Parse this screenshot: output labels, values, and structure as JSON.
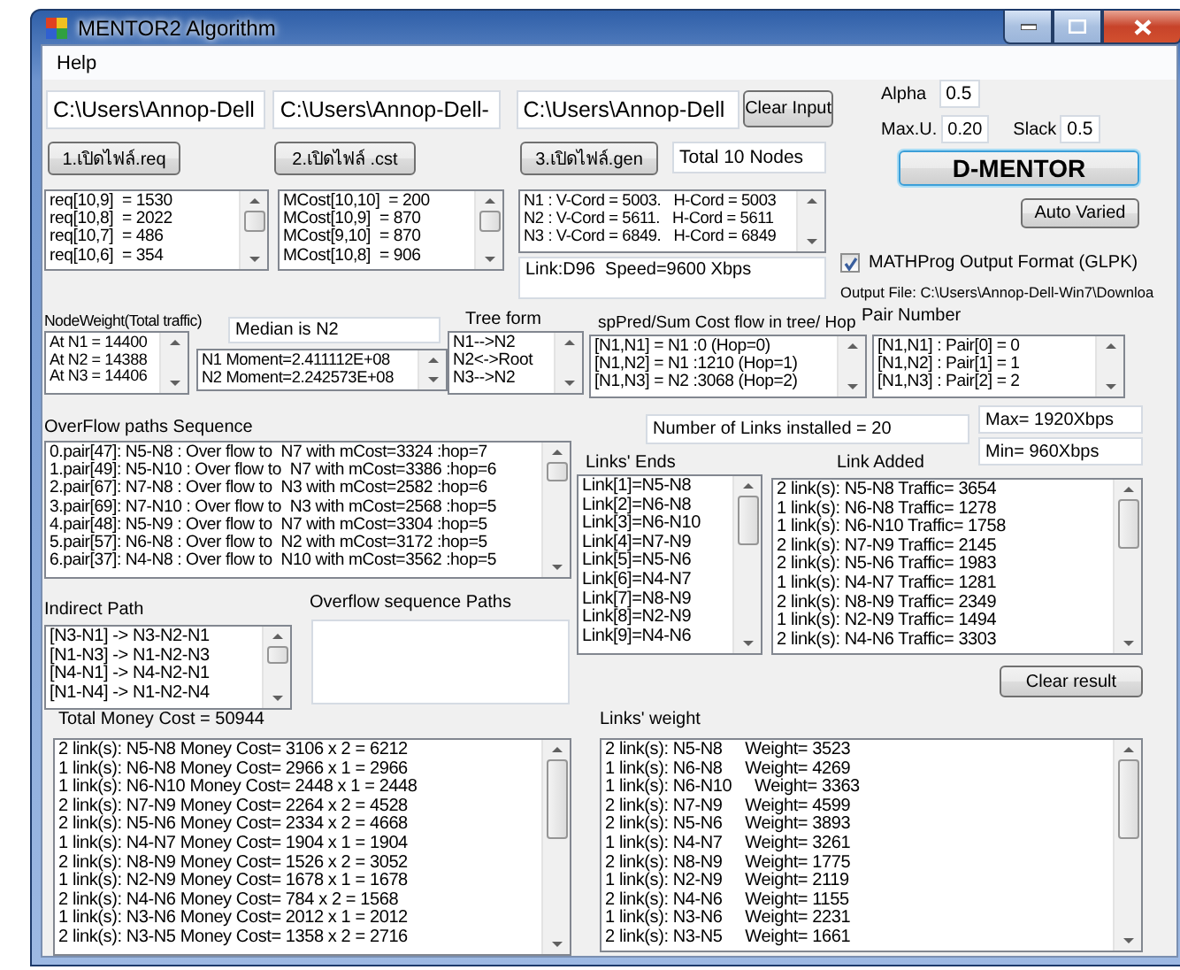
{
  "window": {
    "title": "MENTOR2 Algorithm"
  },
  "menu": [
    "Help"
  ],
  "file_inputs": [
    {
      "value": "C:\\Users\\Annop-Dell"
    },
    {
      "value": "C:\\Users\\Annop-Dell-"
    },
    {
      "value": "C:\\Users\\Annop-Dell"
    }
  ],
  "clear_input_button": "Clear Input",
  "open_buttons": [
    "1.เปิดไฟล์.req",
    "2.เปิดไฟล์ .cst",
    "3.เปิดไฟล์.gen"
  ],
  "total_nodes": "Total 10 Nodes",
  "req_list": [
    "req[10,9]  = 1530",
    "req[10,8]  = 2022",
    "req[10,7]  = 486",
    "req[10,6]  = 354"
  ],
  "cost_list": [
    "MCost[10,10]  = 200",
    "MCost[10,9]  = 870",
    "MCost[9,10]  = 870",
    "MCost[10,8]  = 906"
  ],
  "coord_list": [
    "N1 : V-Cord = 5003.   H-Cord = 5003",
    "N2 : V-Cord = 5611.   H-Cord = 5611",
    "N3 : V-Cord = 6849.   H-Cord = 6849"
  ],
  "link_info": "Link:D96  Speed=9600 Xbps",
  "params": [
    {
      "label": "Alpha",
      "value": "0.5"
    },
    {
      "label": "Max.U.",
      "value": "0.20"
    },
    {
      "label": "Slack",
      "value": "0.5"
    }
  ],
  "run_button": "D-MENTOR",
  "auto_varied_button": "Auto Varied",
  "glpk_checkbox": {
    "label": "MATHProg Output Format (GLPK)",
    "checked": true
  },
  "output_file": "Output File: C:\\Users\\Annop-Dell-Win7\\Downloa",
  "node_weight": {
    "label": "NodeWeight(Total traffic)",
    "lines": [
      "At N1 = 14400",
      "At N2 = 14388",
      "At N3 = 14406"
    ]
  },
  "median": "Median is N2",
  "moments": [
    "N1 Moment=2.411112E+08",
    "N2 Moment=2.242573E+08"
  ],
  "tree_form": {
    "label": "Tree form",
    "lines": [
      "N1-->N2",
      "N2<->Root",
      "N3-->N2"
    ]
  },
  "sp_pred": {
    "label": "spPred/Sum Cost flow in tree/ Hop",
    "lines": [
      "[N1,N1] = N1 :0 (Hop=0)",
      "[N1,N2] = N1 :1210 (Hop=1)",
      "[N1,N3] = N2 :3068 (Hop=2)"
    ]
  },
  "pair_number": {
    "label": "Pair Number",
    "lines": [
      "[N1,N1] : Pair[0] = 0",
      "[N1,N2] : Pair[1] = 1",
      "[N1,N3] : Pair[2] = 2"
    ]
  },
  "overflow_paths": {
    "label": "OverFlow paths Sequence",
    "lines": [
      "0.pair[47]: N5-N8 : Over flow to  N7 with mCost=3324 :hop=7",
      "1.pair[49]: N5-N10 : Over flow to  N7 with mCost=3386 :hop=6",
      "2.pair[67]: N7-N8 : Over flow to  N3 with mCost=2582 :hop=6",
      "3.pair[69]: N7-N10 : Over flow to  N3 with mCost=2568 :hop=5",
      "4.pair[48]: N5-N9 : Over flow to  N7 with mCost=3304 :hop=5",
      "5.pair[57]: N6-N8 : Over flow to  N2 with mCost=3172 :hop=5",
      "6.pair[37]: N4-N8 : Over flow to  N10 with mCost=3562 :hop=5"
    ]
  },
  "indirect_path": {
    "label": "Indirect Path",
    "lines": [
      "[N3-N1] -> N3-N2-N1",
      "[N1-N3] -> N1-N2-N3",
      "[N4-N1] -> N4-N2-N1",
      "[N1-N4] -> N1-N2-N4"
    ]
  },
  "overflow_sequence_paths": {
    "label": "Overflow sequence Paths"
  },
  "links_installed": "Number of Links installed = 20",
  "max": "Max= 1920Xbps",
  "min": "Min= 960Xbps",
  "links_ends": {
    "label": "Links' Ends",
    "lines": [
      "Link[1]=N5-N8",
      "Link[2]=N6-N8",
      "Link[3]=N6-N10",
      "Link[4]=N7-N9",
      "Link[5]=N5-N6",
      "Link[6]=N4-N7",
      "Link[7]=N8-N9",
      "Link[8]=N2-N9",
      "Link[9]=N4-N6"
    ]
  },
  "link_added": {
    "label": "Link Added",
    "lines": [
      "2 link(s): N5-N8 Traffic= 3654",
      "1 link(s): N6-N8 Traffic= 1278",
      "1 link(s): N6-N10 Traffic= 1758",
      "2 link(s): N7-N9 Traffic= 2145",
      "2 link(s): N5-N6 Traffic= 1983",
      "1 link(s): N4-N7 Traffic= 1281",
      "2 link(s): N8-N9 Traffic= 2349",
      "1 link(s): N2-N9 Traffic= 1494",
      "2 link(s): N4-N6 Traffic= 3303"
    ]
  },
  "clear_result_button": "Clear result",
  "total_money_cost": {
    "label": "Total Money Cost = 50944",
    "lines": [
      "2 link(s): N5-N8 Money Cost= 3106 x 2 = 6212",
      "1 link(s): N6-N8 Money Cost= 2966 x 1 = 2966",
      "1 link(s): N6-N10 Money Cost= 2448 x 1 = 2448",
      "2 link(s): N7-N9 Money Cost= 2264 x 2 = 4528",
      "2 link(s): N5-N6 Money Cost= 2334 x 2 = 4668",
      "1 link(s): N4-N7 Money Cost= 1904 x 1 = 1904",
      "2 link(s): N8-N9 Money Cost= 1526 x 2 = 3052",
      "1 link(s): N2-N9 Money Cost= 1678 x 1 = 1678",
      "2 link(s): N4-N6 Money Cost= 784 x 2 = 1568",
      "1 link(s): N3-N6 Money Cost= 2012 x 1 = 2012",
      "2 link(s): N3-N5 Money Cost= 1358 x 2 = 2716"
    ]
  },
  "links_weight": {
    "label": "Links' weight",
    "lines": [
      "2 link(s): N5-N8     Weight= 3523",
      "1 link(s): N6-N8     Weight= 4269",
      "1 link(s): N6-N10     Weight= 3363",
      "2 link(s): N7-N9     Weight= 4599",
      "2 link(s): N5-N6     Weight= 3893",
      "1 link(s): N4-N7     Weight= 3261",
      "2 link(s): N8-N9     Weight= 1775",
      "1 link(s): N2-N9     Weight= 2119",
      "2 link(s): N4-N6     Weight= 1155",
      "1 link(s): N3-N6     Weight= 2231",
      "2 link(s): N3-N5     Weight= 1661"
    ]
  }
}
